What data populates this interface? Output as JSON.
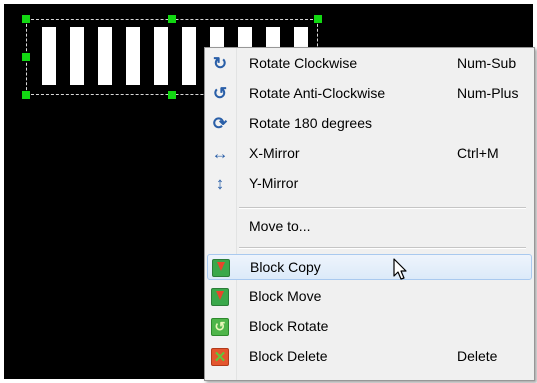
{
  "menu": {
    "items": [
      {
        "label": "Rotate Clockwise",
        "shortcut": "Num-Sub",
        "icon": "rotate-clockwise-icon",
        "glyph": "↻"
      },
      {
        "label": "Rotate Anti-Clockwise",
        "shortcut": "Num-Plus",
        "icon": "rotate-anticlockwise-icon",
        "glyph": "↺"
      },
      {
        "label": "Rotate 180 degrees",
        "shortcut": "",
        "icon": "rotate-180-icon",
        "glyph": "⟳"
      },
      {
        "label": "X-Mirror",
        "shortcut": "Ctrl+M",
        "icon": "x-mirror-icon",
        "glyph": "↔"
      },
      {
        "label": "Y-Mirror",
        "shortcut": "",
        "icon": "y-mirror-icon",
        "glyph": "↕"
      },
      {
        "label": "Move to...",
        "shortcut": ""
      },
      {
        "label": "Block Copy",
        "shortcut": "",
        "icon": "block-copy-icon",
        "highlighted": true
      },
      {
        "label": "Block Move",
        "shortcut": "",
        "icon": "block-move-icon"
      },
      {
        "label": "Block Rotate",
        "shortcut": "",
        "icon": "block-rotate-icon",
        "glyph": "↺"
      },
      {
        "label": "Block Delete",
        "shortcut": "Delete",
        "icon": "block-delete-icon",
        "glyph": "✕"
      }
    ]
  },
  "colors": {
    "canvas_bg": "#000000",
    "selection_handle": "#12d812",
    "menu_bg": "#f0f0f0",
    "highlight": "#dceaf9",
    "icon_blue": "#2a5fa8"
  },
  "selection": {
    "strip_count": 10
  }
}
